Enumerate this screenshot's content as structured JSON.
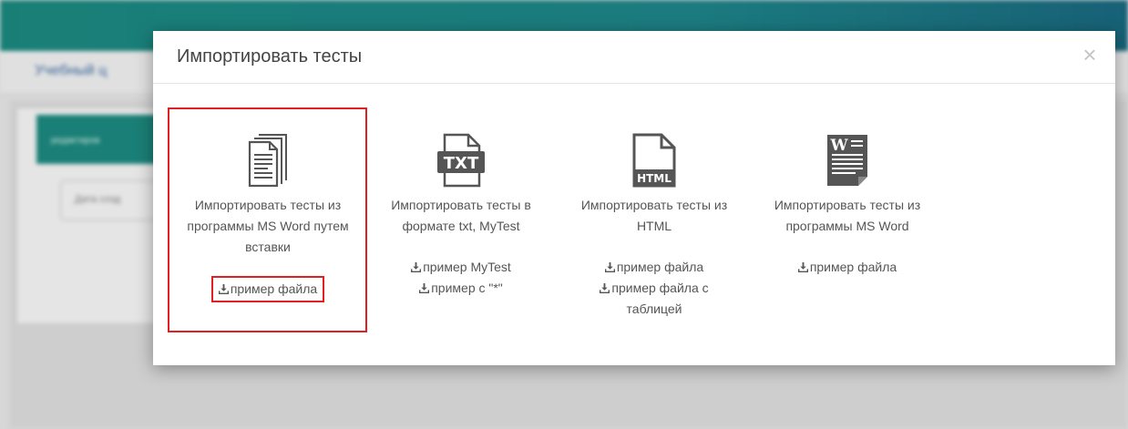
{
  "background": {
    "breadcrumb": "Учебный ц",
    "panel_header": "редактиров",
    "field_text": "Дата созд"
  },
  "modal": {
    "title": "Импортировать тесты",
    "close_symbol": "×",
    "options": [
      {
        "icon": "document-pages-icon",
        "label": "Импортировать тесты из программы MS Word путем вставки",
        "links": [
          "пример файла"
        ]
      },
      {
        "icon": "txt-file-icon",
        "icon_text": "TXT",
        "label": "Импортировать тесты в формате txt, MyTest",
        "links": [
          "пример MyTest",
          "пример с \"*\""
        ]
      },
      {
        "icon": "html-file-icon",
        "icon_text": "HTML",
        "label": "Импортировать тесты из HTML",
        "links": [
          "пример файла",
          "пример файла с таблицей"
        ]
      },
      {
        "icon": "word-file-icon",
        "icon_text": "W",
        "label": "Импортировать тесты из программы MS Word",
        "links": [
          "пример файла"
        ]
      }
    ]
  },
  "colors": {
    "header": "#1c8e84",
    "highlight": "#e02020",
    "text": "#555555"
  }
}
